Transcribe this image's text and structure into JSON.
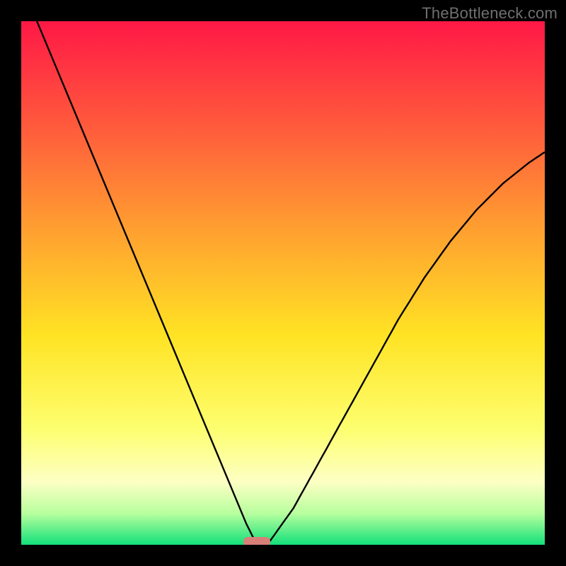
{
  "watermark": "TheBottleneck.com",
  "chart_data": {
    "type": "line",
    "title": "",
    "xlabel": "",
    "ylabel": "",
    "xlim": [
      0,
      1
    ],
    "ylim": [
      0,
      1
    ],
    "minimum_x": 0.45,
    "minimum_y": 0.0,
    "series": [
      {
        "name": "left-branch",
        "x": [
          0.03,
          0.08,
          0.13,
          0.18,
          0.23,
          0.28,
          0.33,
          0.38,
          0.43,
          0.45
        ],
        "y": [
          1.0,
          0.88,
          0.76,
          0.64,
          0.52,
          0.4,
          0.28,
          0.16,
          0.04,
          0.0
        ]
      },
      {
        "name": "right-branch",
        "x": [
          0.47,
          0.52,
          0.57,
          0.62,
          0.67,
          0.72,
          0.77,
          0.82,
          0.87,
          0.92,
          0.97,
          1.0
        ],
        "y": [
          0.0,
          0.07,
          0.16,
          0.25,
          0.34,
          0.43,
          0.51,
          0.58,
          0.64,
          0.69,
          0.73,
          0.75
        ]
      }
    ],
    "marker": {
      "x": 0.45,
      "y": 0.0,
      "color": "#d88078"
    },
    "background_gradient": {
      "stops": [
        {
          "offset": 0.0,
          "color": "#ff1846"
        },
        {
          "offset": 0.2,
          "color": "#ff5a3c"
        },
        {
          "offset": 0.4,
          "color": "#ffa030"
        },
        {
          "offset": 0.6,
          "color": "#ffe324"
        },
        {
          "offset": 0.78,
          "color": "#fdff70"
        },
        {
          "offset": 0.88,
          "color": "#fdffc4"
        },
        {
          "offset": 0.94,
          "color": "#b8ff9e"
        },
        {
          "offset": 1.0,
          "color": "#12e07a"
        }
      ]
    }
  }
}
